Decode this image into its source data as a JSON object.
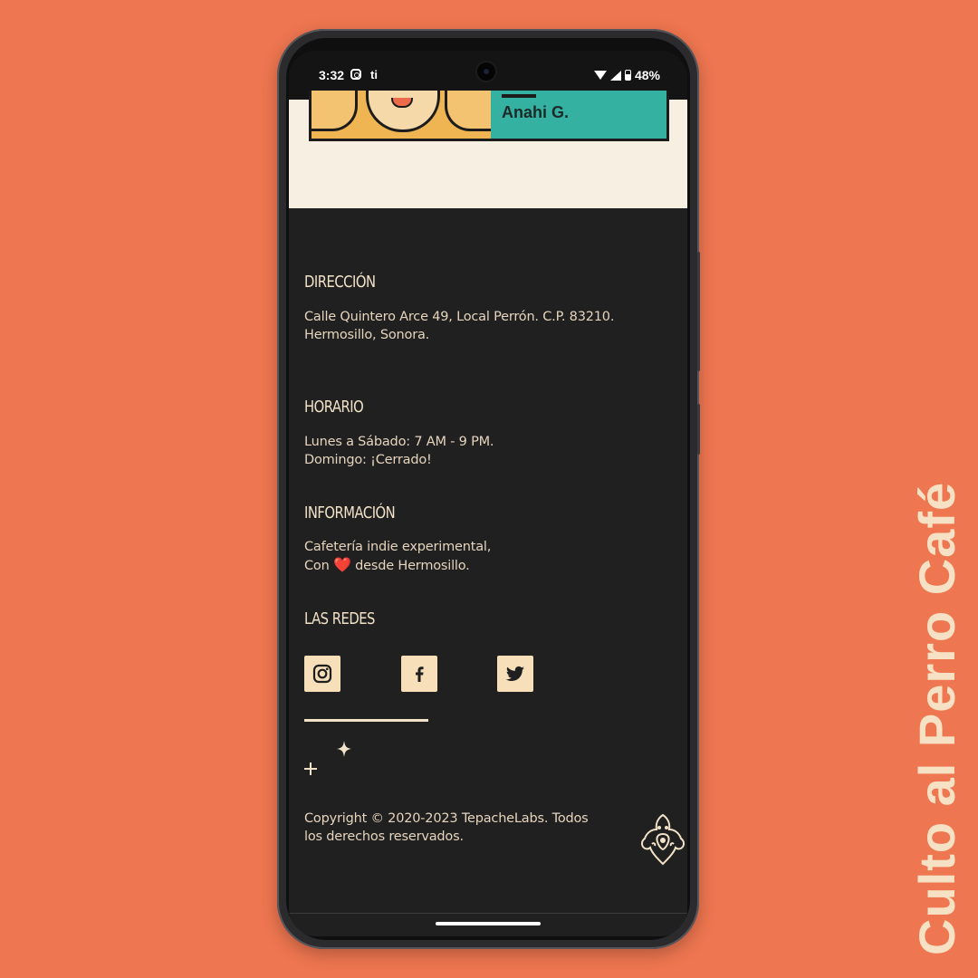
{
  "side_title": "Culto al Perro Café",
  "status_bar": {
    "time": "3:32",
    "battery": "48%",
    "teams_icon": "ti"
  },
  "card": {
    "name": "Anahi G."
  },
  "sections": {
    "direccion": {
      "title": "DIRECCIÓN",
      "line1": "Calle Quintero Arce 49, Local Perrón. C.P. 83210.",
      "line2": "Hermosillo, Sonora."
    },
    "horario": {
      "title": "HORARIO",
      "line1": "Lunes a Sábado: 7 AM - 9 PM.",
      "line2": "Domingo: ¡Cerrado!"
    },
    "informacion": {
      "title": "INFORMACIÓN",
      "line1": "Cafetería indie experimental,",
      "line2_pre": "Con",
      "heart": "❤️",
      "line2_post": "desde Hermosillo."
    },
    "redes": {
      "title": "LAS REDES",
      "icons": [
        "instagram-icon",
        "facebook-icon",
        "twitter-icon"
      ]
    }
  },
  "footer": {
    "copyright_line1": "Copyright © 2020-2023 TepacheLabs. Todos",
    "copyright_line2": "los derechos reservados."
  },
  "colors": {
    "background": "#ee7650",
    "cream": "#f8efe3",
    "dark": "#202020",
    "accent_teal": "#35b1a1",
    "text": "#e6d5be"
  }
}
